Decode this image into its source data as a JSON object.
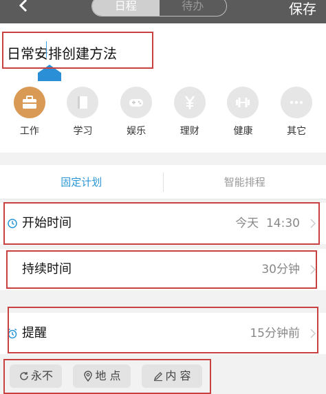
{
  "header": {
    "segments": [
      "日程",
      "待办"
    ],
    "save_label": "保存"
  },
  "title": {
    "value": "日常安排创建方法"
  },
  "categories": [
    {
      "label": "工作",
      "icon": "briefcase-icon",
      "active": true
    },
    {
      "label": "学习",
      "icon": "book-icon"
    },
    {
      "label": "娱乐",
      "icon": "gamepad-icon"
    },
    {
      "label": "理财",
      "icon": "yen-icon"
    },
    {
      "label": "健康",
      "icon": "dumbbell-icon"
    },
    {
      "label": "其它",
      "icon": "more-icon"
    }
  ],
  "tabs": [
    "固定计划",
    "智能排程"
  ],
  "rows": {
    "start": {
      "label": "开始时间",
      "value": "今天  14:30"
    },
    "duration": {
      "label": "持续时间",
      "value": "30分钟"
    },
    "reminder": {
      "label": "提醒",
      "value": "15分钟前"
    }
  },
  "chips": [
    "永不",
    "地 点",
    "内 容"
  ],
  "colors": {
    "accent": "#2a96d6",
    "category_active": "#d99a55",
    "highlight": "#c8403f",
    "topbar": "#5b5b5b"
  }
}
